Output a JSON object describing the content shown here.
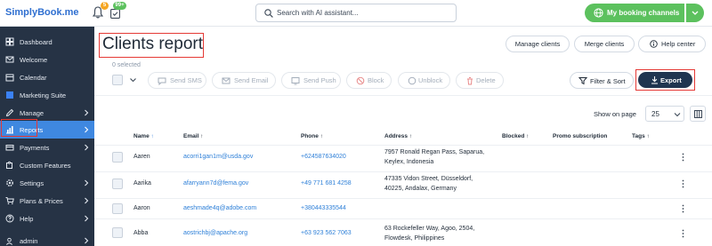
{
  "header": {
    "logo": "SimplyBook.me",
    "notifications_badge": "5",
    "calendar_badge": "99+",
    "search_placeholder": "Search with AI assistant...",
    "booking_channels_label": "My booking channels"
  },
  "sidebar": {
    "items": [
      {
        "label": "Dashboard",
        "icon": "dashboard-icon",
        "arrow": false
      },
      {
        "label": "Welcome",
        "icon": "welcome-icon",
        "arrow": false
      },
      {
        "label": "Calendar",
        "icon": "calendar-icon",
        "arrow": false
      },
      {
        "label": "Marketing Suite",
        "icon": "marketing-icon",
        "arrow": false
      },
      {
        "label": "Manage",
        "icon": "pencil-icon",
        "arrow": true
      },
      {
        "label": "Reports",
        "icon": "chart-icon",
        "arrow": true,
        "active": true
      },
      {
        "label": "Payments",
        "icon": "payments-icon",
        "arrow": true
      },
      {
        "label": "Custom Features",
        "icon": "puzzle-icon",
        "arrow": false
      },
      {
        "label": "Settings",
        "icon": "gear-icon",
        "arrow": true
      },
      {
        "label": "Plans & Prices",
        "icon": "cart-icon",
        "arrow": true
      },
      {
        "label": "Help",
        "icon": "help-icon",
        "arrow": true
      }
    ],
    "user": "admin"
  },
  "page": {
    "title": "Clients report",
    "manage_clients": "Manage clients",
    "merge_clients": "Merge clients",
    "help_center": "Help center",
    "selected_text": "0 selected"
  },
  "actions": {
    "send_sms": "Send SMS",
    "send_email": "Send Email",
    "send_push": "Send Push",
    "block": "Block",
    "unblock": "Unblock",
    "delete": "Delete",
    "filter_sort": "Filter & Sort",
    "export": "Export"
  },
  "pagination": {
    "show_on_page_label": "Show on page",
    "page_size": "25"
  },
  "table": {
    "columns": {
      "name": "Name",
      "email": "Email",
      "phone": "Phone",
      "address": "Address",
      "blocked": "Blocked",
      "promo": "Promo subscription",
      "tags": "Tags"
    },
    "rows": [
      {
        "name": "Aaren",
        "email": "acorri1gan1m@usda.gov",
        "phone": "+624587634020",
        "address_1": "7957 Ronald Regan Pass, Saparua,",
        "address_2": "Keylex, Indonesia"
      },
      {
        "name": "Aarika",
        "email": "afarryann7d@fema.gov",
        "phone": "+49 771 681 4258",
        "address_1": "47335 Vidon Street, Düsseldorf,",
        "address_2": "40225, Andalax, Germany"
      },
      {
        "name": "Aaron",
        "email": "aeshmade4q@adobe.com",
        "phone": "+380443335544",
        "address_1": "",
        "address_2": ""
      },
      {
        "name": "Abba",
        "email": "aostrichbj@apache.org",
        "phone": "+63 923 562 7063",
        "address_1": "63 Rockefeller Way, Agoo, 2504,",
        "address_2": "Flowdesk, Philippines"
      }
    ]
  },
  "colors": {
    "sidebar_bg": "#263345",
    "active_nav": "#3f88e0",
    "brand_green": "#5cc15e",
    "export_bg": "#1f3550",
    "link": "#2f80d8",
    "highlight": "#e53935"
  }
}
